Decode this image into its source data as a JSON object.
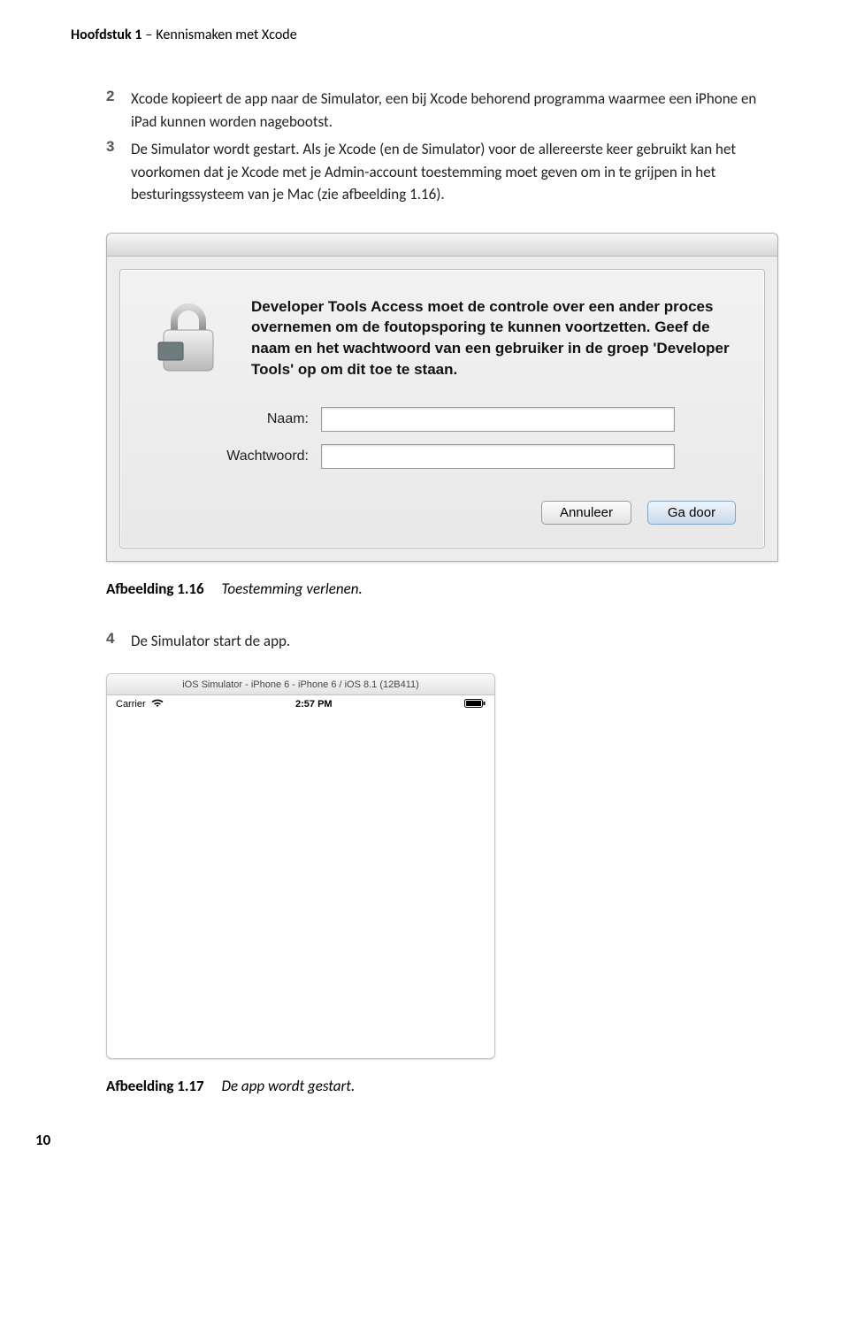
{
  "chapter": {
    "prefix": "Hoofdstuk 1",
    "title": "Kennismaken met Xcode"
  },
  "steps": [
    {
      "num": "2",
      "text": "Xcode kopieert de app naar de Simulator, een bij Xcode behorend programma waarmee een iPhone en iPad kunnen worden nagebootst."
    },
    {
      "num": "3",
      "text": "De Simulator wordt gestart. Als je Xcode (en de Simulator) voor de allereerste keer gebruikt kan het voorkomen dat je Xcode met je Admin-account toestemming moet geven om in te grijpen in het besturingssysteem van je Mac (zie afbeelding 1.16)."
    }
  ],
  "dialog": {
    "message": "Developer Tools Access moet de controle over een ander proces overnemen om de foutopsporing te kunnen voortzetten. Geef de naam en het wachtwoord van een gebruiker in de groep 'Developer Tools' op om dit toe te staan.",
    "name_label": "Naam:",
    "password_label": "Wachtwoord:",
    "name_value": "",
    "password_value": "",
    "cancel": "Annuleer",
    "ok": "Ga door"
  },
  "caption1": {
    "label": "Afbeelding 1.16",
    "text": "Toestemming verlenen."
  },
  "step4": {
    "num": "4",
    "text": "De Simulator start de app."
  },
  "simulator": {
    "title": "iOS Simulator - iPhone 6 - iPhone 6 / iOS 8.1 (12B411)",
    "carrier": "Carrier",
    "time": "2:57 PM"
  },
  "caption2": {
    "label": "Afbeelding 1.17",
    "text": "De app wordt gestart."
  },
  "page_number": "10"
}
